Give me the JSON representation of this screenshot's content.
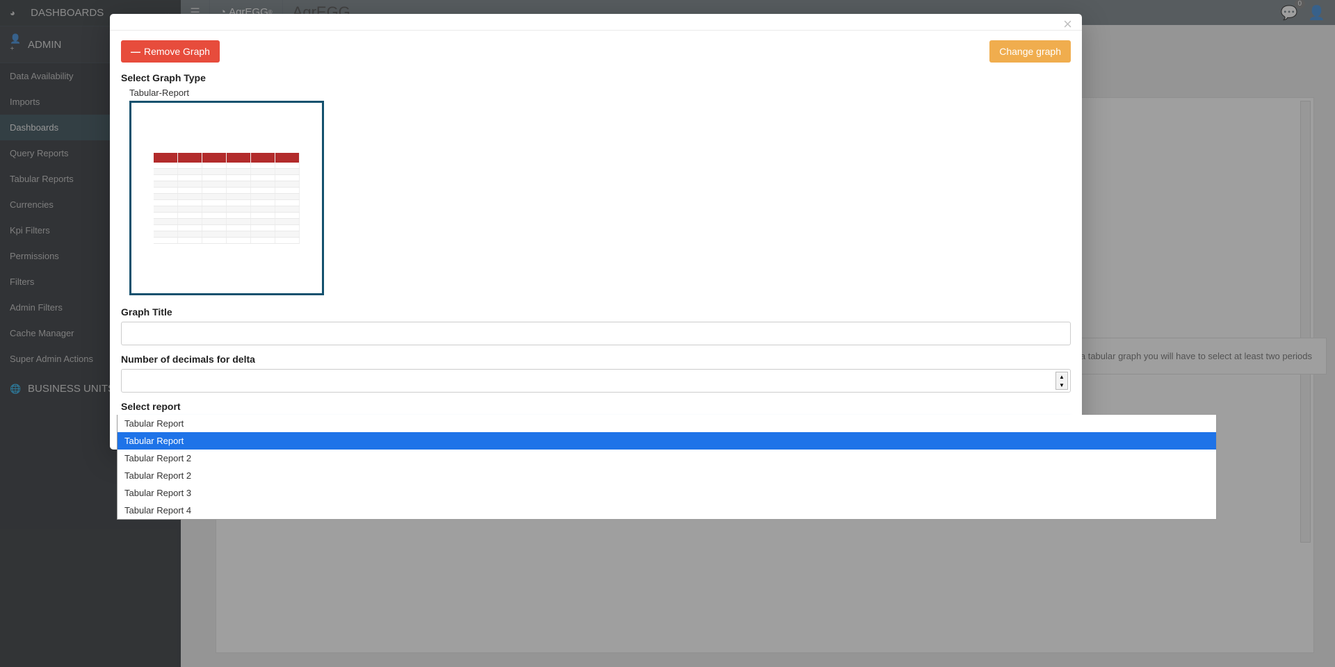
{
  "sidebar": {
    "dashboards_label": "DASHBOARDS",
    "admin_label": "ADMIN",
    "business_units_label": "BUSINESS UNITS",
    "admin_items": [
      "Data Availability",
      "Imports",
      "Dashboards",
      "Query Reports",
      "Tabular Reports",
      "Currencies",
      "Kpi Filters",
      "Permissions",
      "Filters",
      "Admin Filters",
      "Cache Manager",
      "Super Admin Actions"
    ],
    "active_index": 2
  },
  "topbar": {
    "logo_text": "AgrEGG",
    "brand_title": "AgrEGG",
    "notification_count": "0"
  },
  "background_hint": "In a tabular graph you will have to select at least two periods",
  "modal": {
    "remove_label": "Remove Graph",
    "change_label": "Change graph",
    "select_graph_type_label": "Select Graph Type",
    "graph_type_name": "Tabular-Report",
    "graph_title_label": "Graph Title",
    "graph_title_value": "",
    "decimals_label": "Number of decimals for delta",
    "decimals_value": "",
    "select_report_label": "Select report",
    "selected_report": "Tabular Report 3",
    "report_options": [
      "Tabular Report",
      "Tabular Report",
      "Tabular Report 2",
      "Tabular Report 2",
      "Tabular Report 3",
      "Tabular Report 4"
    ],
    "highlight_index": 1
  }
}
